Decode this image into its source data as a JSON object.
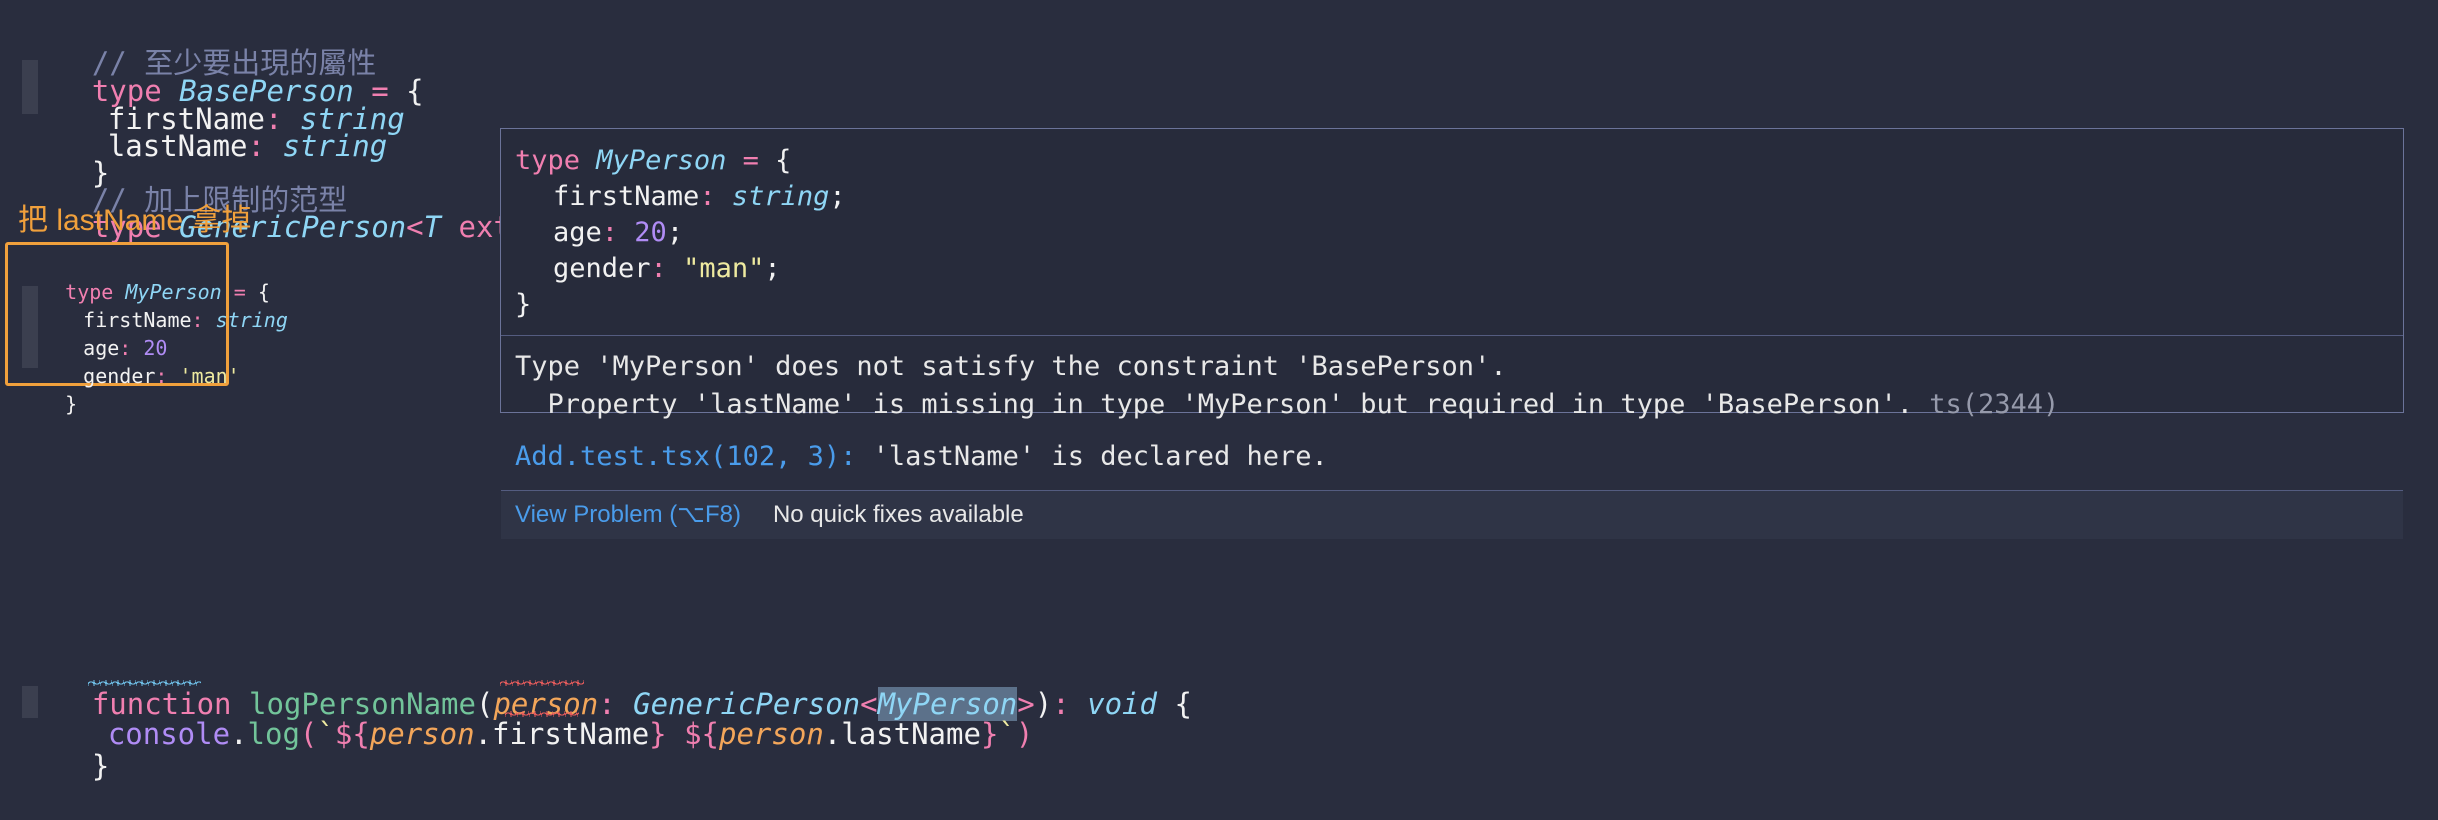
{
  "editor": {
    "background": "#292d3e",
    "lines": [
      {
        "id": "l1",
        "text": "// 至少要出現的屬性"
      },
      {
        "id": "l2",
        "text": "type BasePerson = {"
      },
      {
        "id": "l3",
        "text": "  firstName: string"
      },
      {
        "id": "l4",
        "text": "  lastName: string"
      },
      {
        "id": "l5",
        "text": "}"
      },
      {
        "id": "l6",
        "text": "// 加上限制的范型"
      },
      {
        "id": "l7",
        "text": "type GenericPerson<T extends BasePerson> = T"
      },
      {
        "id": "l8",
        "text": "type MyPerson = {"
      },
      {
        "id": "l9",
        "text": "  firstName: string"
      },
      {
        "id": "l10",
        "text": "  age: 20"
      },
      {
        "id": "l11",
        "text": "  gender: 'man'"
      },
      {
        "id": "l12",
        "text": "}"
      },
      {
        "id": "l13",
        "text": "function logPersonName(person: GenericPerson<MyPerson>): void {"
      },
      {
        "id": "l14",
        "text": "  console.log(`${person.firstName} ${person.lastName}`)"
      },
      {
        "id": "l15",
        "text": "}"
      }
    ],
    "tokens": {
      "comment1": "// 至少要出現的屬性",
      "comment2": "// 加上限制的范型",
      "kw_type": "type",
      "name_baseperson": "BasePerson",
      "name_genericperson": "GenericPerson",
      "name_myperson": "MyPerson",
      "kw_extends": "extends",
      "kw_function": "function",
      "name_logpersonname": "logPersonName",
      "param_person": "person",
      "kw_void": "void",
      "obj_console": "console",
      "method_log": "log",
      "prop_firstname": "firstName",
      "prop_lastname": "lastName",
      "prop_age": "age",
      "prop_gender": "gender",
      "type_string": "string",
      "type_T": "T",
      "val_20": "20",
      "val_man_single": "'man'",
      "val_man_double": "\"man\""
    }
  },
  "annotation": {
    "text": "把 lastName 拿掉",
    "color": "#f0a03c",
    "box_border_color": "#f0a03c"
  },
  "tooltip": {
    "border_color": "#6b7399",
    "background": "#272b3b",
    "code": [
      "type MyPerson = {",
      "    firstName: string;",
      "    age: 20;",
      "    gender: \"man\";",
      "}"
    ],
    "message_line_1": "Type 'MyPerson' does not satisfy the constraint 'BasePerson'.",
    "message_line_2_prefix": "  Property 'lastName' is missing in type 'MyPerson' but required in type 'BasePerson'.",
    "message_code": " ts(2344)",
    "link_file": "Add.test.tsx(102, 3):",
    "link_rest": " 'lastName' is declared here.",
    "footer_action": "View Problem (⌥F8)",
    "footer_note": "No quick fixes available"
  }
}
